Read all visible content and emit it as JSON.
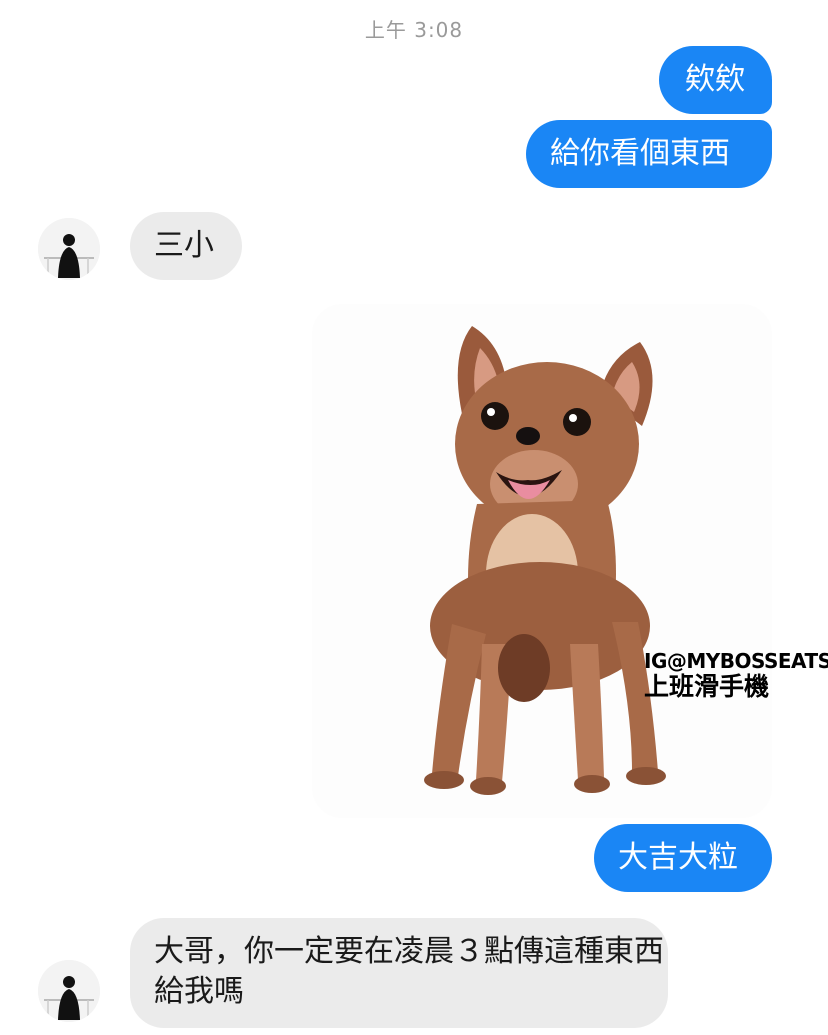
{
  "chat": {
    "timestamp": "上午 3:08",
    "messages": [
      {
        "from": "me",
        "text": "欸欸"
      },
      {
        "from": "me",
        "text": "給你看個東西"
      },
      {
        "from": "them",
        "text": "三小"
      },
      {
        "from": "me",
        "type": "image",
        "image_icon": "chihuahua-photo"
      },
      {
        "from": "me",
        "text": "大吉大粒"
      },
      {
        "from": "them",
        "text": "大哥，你一定要在凌晨３點傳這種東西給我嗎"
      }
    ]
  },
  "watermark": {
    "line1": "IG@MYBOSSEATSHI",
    "line2": "上班滑手機"
  },
  "colors": {
    "outgoing_bubble": "#1a86f5",
    "incoming_bubble": "#ebebeb",
    "timestamp": "#9a9a9a"
  }
}
